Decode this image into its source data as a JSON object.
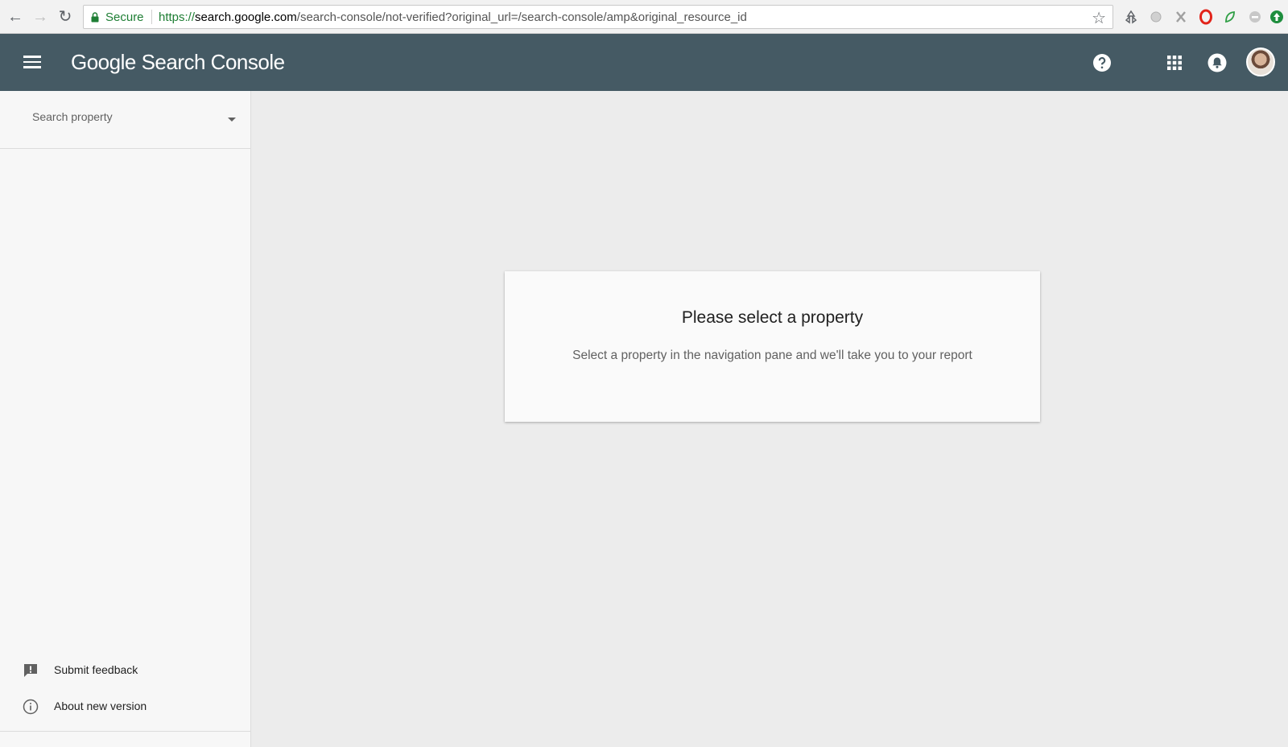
{
  "browser": {
    "secure_label": "Secure",
    "url_scheme": "https://",
    "url_host": "search.google.com",
    "url_path": "/search-console/not-verified?original_url=/search-console/amp&original_resource_id",
    "icons": [
      "back-icon",
      "forward-icon",
      "reload-icon",
      "lock-icon",
      "star-icon",
      "recycle-extension-icon",
      "circle-extension-icon",
      "x-extension-icon",
      "opera-extension-icon",
      "leaf-extension-icon",
      "toggle-extension-icon",
      "arrow-up-extension-icon"
    ]
  },
  "header": {
    "logo_text": "Google Search Console",
    "background_color": "#455a64",
    "icons": [
      "menu-icon",
      "help-icon",
      "apps-grid-icon",
      "notifications-bell-icon",
      "avatar"
    ]
  },
  "sidebar": {
    "search_placeholder": "Search property",
    "items": [
      {
        "label": "Submit feedback",
        "icon": "feedback-icon"
      },
      {
        "label": "About new version",
        "icon": "info-icon"
      }
    ]
  },
  "main": {
    "title": "Please select a property",
    "description": "Select a property in the navigation pane and we'll take you to your report"
  }
}
